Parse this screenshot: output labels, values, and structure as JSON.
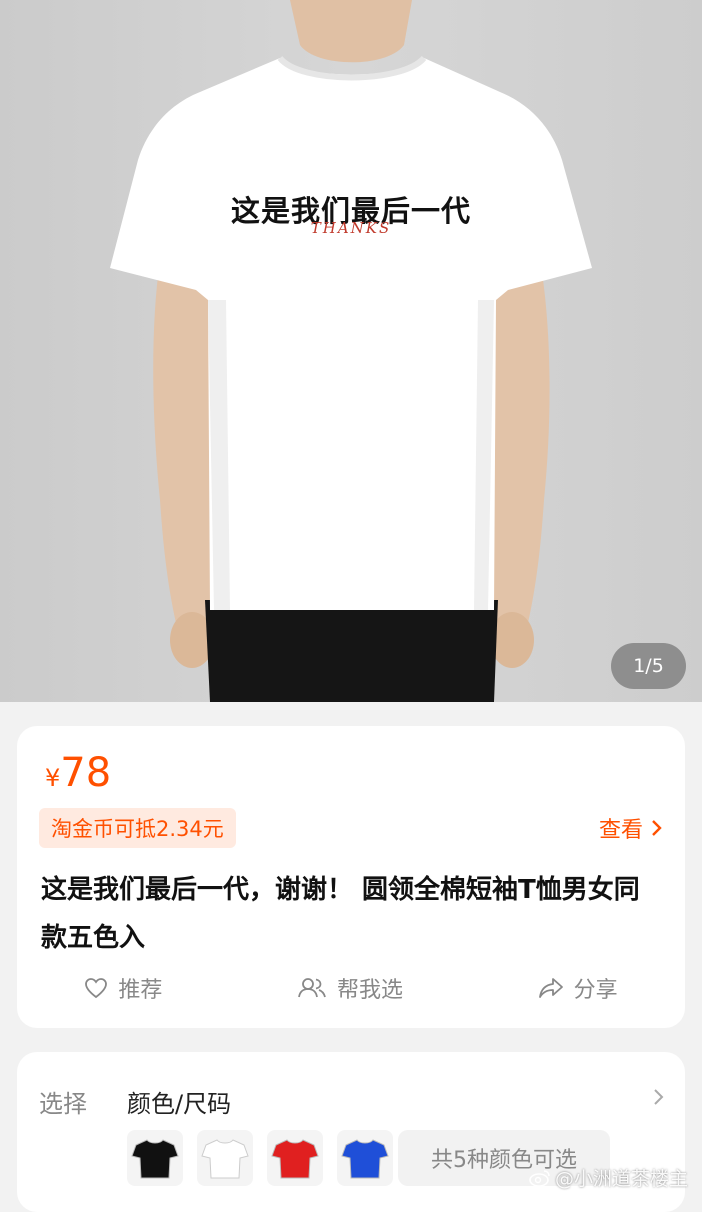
{
  "gallery": {
    "shirt_text": "这是我们最后一代",
    "shirt_subtext": "THANKS",
    "page_indicator": "1/5"
  },
  "product": {
    "currency": "¥",
    "price": "78",
    "coin_discount": "淘金币可抵2.34元",
    "view_link": "查看",
    "title": "这是我们最后一代，谢谢！ 圆领全棉短袖T恤男女同款五色入"
  },
  "actions": [
    {
      "label": "推荐",
      "icon": "heart-icon"
    },
    {
      "label": "帮我选",
      "icon": "people-icon"
    },
    {
      "label": "分享",
      "icon": "share-icon"
    }
  ],
  "selection": {
    "label": "选择",
    "value": "颜色/尺码",
    "thumbnail_colors": [
      "#111111",
      "#ffffff",
      "#e02020",
      "#1f4fd8"
    ],
    "more_colors": "共5种颜色可选"
  },
  "watermark": "@小洲道茶楼主",
  "colors": {
    "accent": "#ff5000",
    "accent_light": "#ffeae0"
  }
}
